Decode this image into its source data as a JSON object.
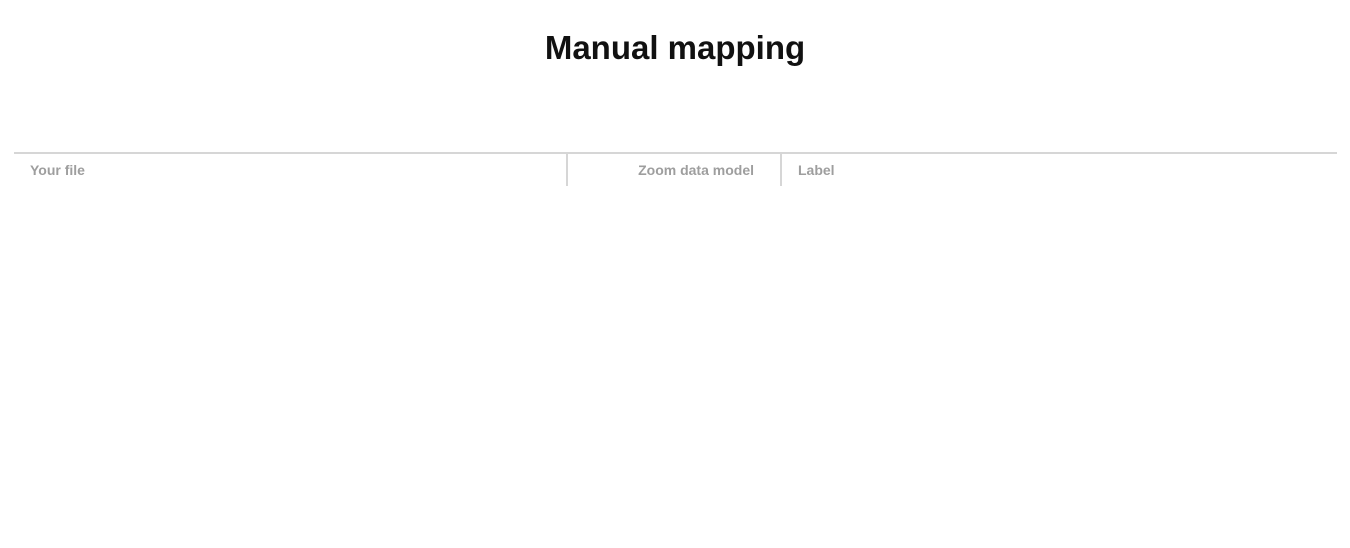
{
  "page": {
    "title": "Manual mapping"
  },
  "table": {
    "columns": [
      {
        "label": "Your file"
      },
      {
        "label": "Zoom data model"
      },
      {
        "label": "Label"
      }
    ]
  }
}
